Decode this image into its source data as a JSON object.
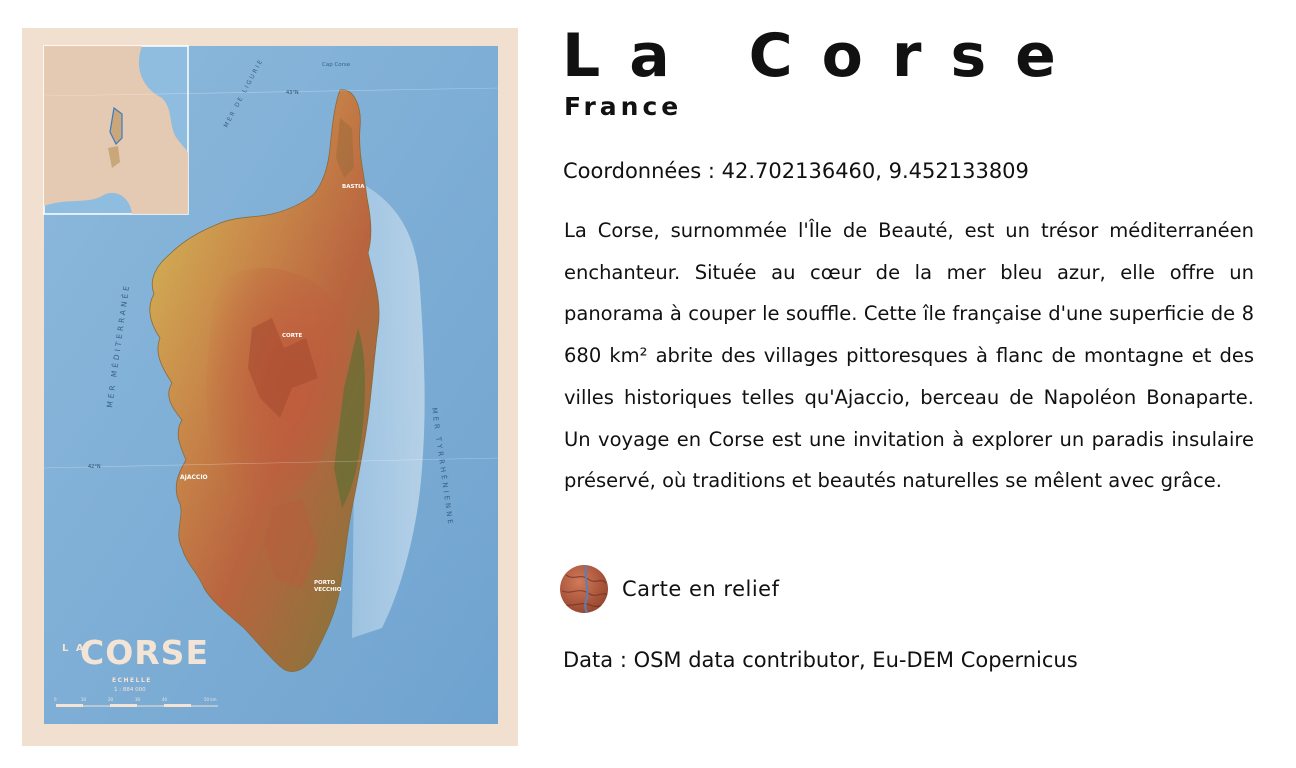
{
  "header": {
    "title": "La Corse",
    "subtitle": "France"
  },
  "coordinates": {
    "text": "Coordonnées : 42.702136460, 9.452133809"
  },
  "description": {
    "text": "La Corse, surnommée l'Île de Beauté, est un trésor méditerranéen enchanteur. Située au cœur de la mer bleu azur, elle offre un panorama à couper le souffle.  Cette île française d'une superficie de 8 680 km² abrite des villages pittoresques à flanc de montagne et des villes historiques telles qu'Ajaccio, berceau de Napoléon Bonaparte. Un voyage en Corse est une invitation à explorer un paradis insulaire préservé, où traditions et beautés naturelles se mêlent avec grâce."
  },
  "relief": {
    "label": "Carte en relief",
    "icon": "relief-map-thumbnail"
  },
  "data_credits": {
    "text": "Data : OSM data contributor, Eu-DEM Copernicus"
  },
  "poster": {
    "title_small": "L A",
    "title_big": "CORSE",
    "scale_label": "ECHELLE",
    "scale_value": "1 : 884 000",
    "scale_ticks": [
      "0",
      "10",
      "20",
      "30",
      "40",
      "50 km"
    ],
    "sea_west": "MER MÉDITERRANÉE",
    "sea_east": "MER TYRRHÉNIENNE",
    "sea_north": "MER DE LIGURIE",
    "cap_corse": "Cap Corse",
    "lat_north": "43°N",
    "lat_south": "42°N",
    "city_ajaccio": "AJACCIO",
    "city_corte": "CORTE",
    "city_bastia": "BASTIA",
    "city_porto_vecchio_1": "PORTO",
    "city_porto_vecchio_2": "VECCHIO",
    "colors": {
      "sea": "#7fb0d6",
      "frame": "#f1dfcf",
      "land_low": "#c9b24c",
      "land_high": "#c46a43"
    }
  }
}
